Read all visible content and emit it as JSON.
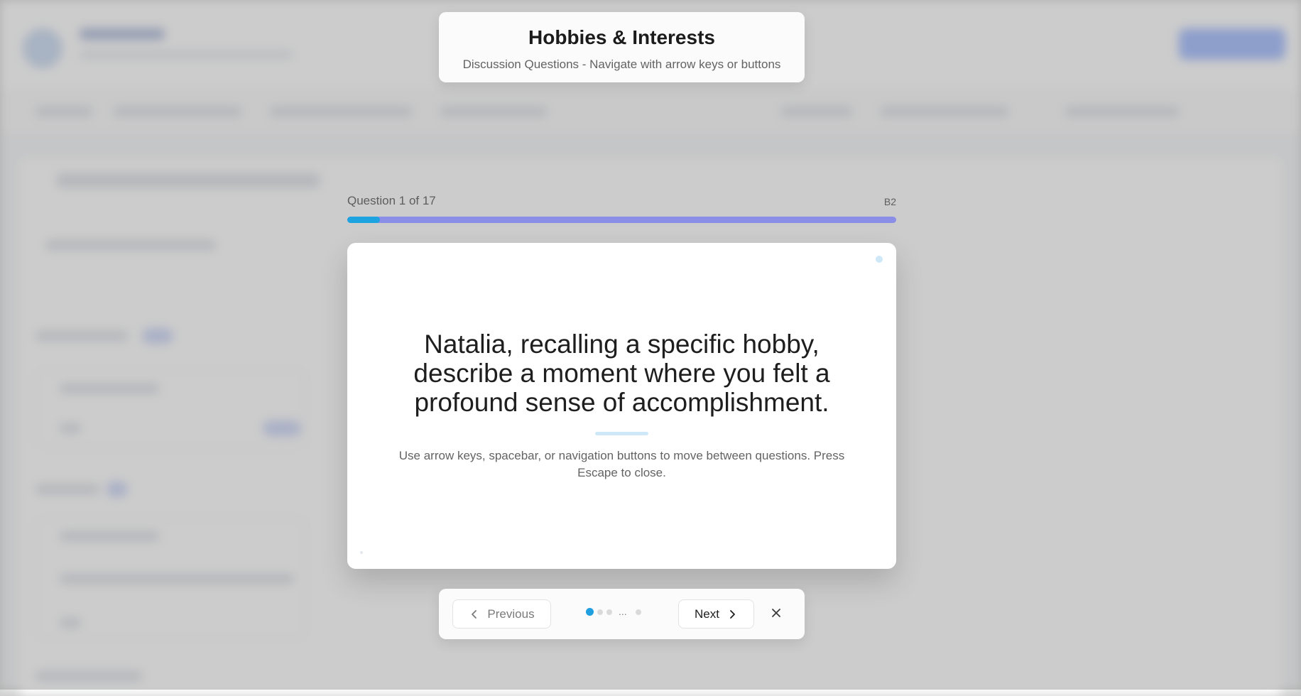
{
  "dialog": {
    "title": "Hobbies & Interests",
    "subtitle": "Discussion Questions - Navigate with arrow keys or buttons"
  },
  "progress": {
    "label": "Question 1 of 17",
    "current": 1,
    "total": 17,
    "fraction": 0.059,
    "level": "B2",
    "fill_color": "#1da3e0",
    "track_color": "#8b8ee6"
  },
  "question": {
    "text": "Natalia, recalling a specific hobby, describe a moment where you felt a profound sense of accomplishment.",
    "hint": "Use arrow keys, spacebar, or navigation buttons to move between questions. Press Escape to close."
  },
  "navigation": {
    "previous_label": "Previous",
    "next_label": "Next",
    "ellipsis": "...",
    "previous_icon": "chevron-left-icon",
    "next_icon": "chevron-right-icon",
    "close_icon": "close-icon",
    "active_dot_color": "#1f9fe0"
  }
}
